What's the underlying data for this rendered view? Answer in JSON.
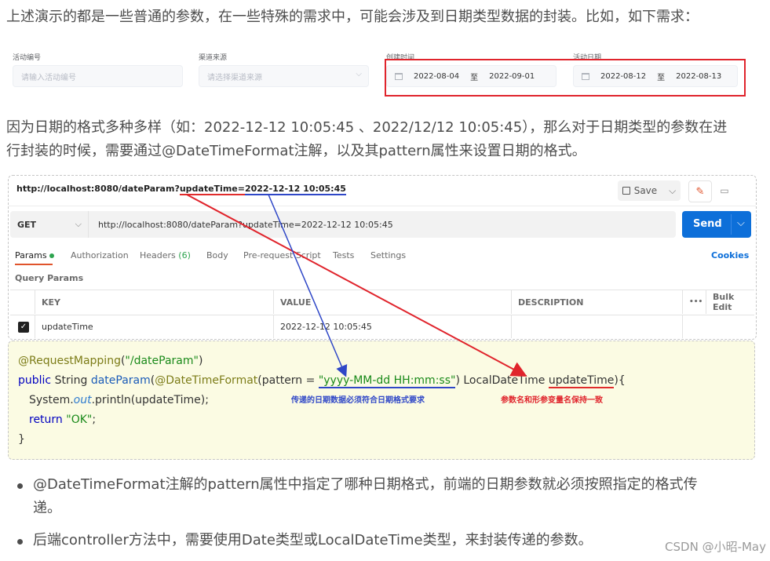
{
  "intro_text": "上述演示的都是一些普通的参数，在一些特殊的需求中，可能会涉及到日期类型数据的封装。比如，如下需求：",
  "form": {
    "activity_no_label": "活动编号",
    "activity_no_placeholder": "请输入活动编号",
    "channel_label": "渠道来源",
    "channel_placeholder": "请选择渠道来源",
    "created_label": "创建时间",
    "created_start": "2022-08-04",
    "created_sep": "至",
    "created_end": "2022-09-01",
    "activity_date_label": "活动日期",
    "activity_start": "2022-08-12",
    "activity_sep": "至",
    "activity_end": "2022-08-13"
  },
  "para2_line1": "因为日期的格式多种多样（如：2022-12-12 10:05:45 、2022/12/12 10:05:45），那么对于日期类型的参数在进",
  "para2_line2": "行封装的时候，需要通过@DateTimeFormat注解，以及其pattern属性来设置日期的格式。",
  "postman": {
    "url_prefix": "http://localhost:8080/dateParam?",
    "url_param_key": "updateTime",
    "url_eq": "=",
    "url_param_value": "2022-12-12 10:05:45",
    "save_label": "Save",
    "method": "GET",
    "request_url": "http://localhost:8080/dateParam?updateTime=2022-12-12 10:05:45",
    "send_label": "Send",
    "tabs": {
      "params": "Params",
      "authorization": "Authorization",
      "headers": "Headers",
      "headers_count": "(6)",
      "body": "Body",
      "prerequest": "Pre-request Script",
      "tests": "Tests",
      "settings": "Settings",
      "cookies": "Cookies"
    },
    "query_params_label": "Query Params",
    "table": {
      "key_header": "KEY",
      "value_header": "VALUE",
      "description_header": "DESCRIPTION",
      "more": "•••",
      "bulk_edit": "Bulk Edit",
      "row_key": "updateTime",
      "row_value": "2022-12-12 10:05:45"
    }
  },
  "code": {
    "l1_ann": "@RequestMapping",
    "l1_paren_open": "(",
    "l1_str": "\"/dateParam\"",
    "l1_paren_close": ")",
    "l2_kw": "public",
    "l2_type": " String ",
    "l2_fn": "dateParam",
    "l2_open": "(",
    "l2_ann": "@DateTimeFormat",
    "l2_pattern": "(pattern = ",
    "l2_str": "\"yyyy-MM-dd HH:mm:ss\"",
    "l2_rest": ") LocalDateTime ",
    "l2_param": "updateTime",
    "l2_end": "){",
    "l3_a": "System.",
    "l3_out": "out",
    "l3_b": ".println(updateTime);",
    "l4_kw": "return",
    "l4_str": "\"OK\"",
    "l4_end": ";",
    "l5": "}",
    "note_blue": "传递的日期数据必须符合日期格式要求",
    "note_red": "参数名和形参变量名保持一致"
  },
  "bullets": [
    "@DateTimeFormat注解的pattern属性中指定了哪种日期格式，前端的日期参数就必须按照指定的格式传",
    "递。",
    "后端controller方法中，需要使用Date类型或LocalDateTime类型，来封装传递的参数。"
  ],
  "watermark": "CSDN @小昭-May",
  "colors": {
    "red_annotation": "#e0242c",
    "blue_annotation": "#2f47c7",
    "send_button": "#0d6fd9",
    "code_bg": "#fbfbe3"
  }
}
